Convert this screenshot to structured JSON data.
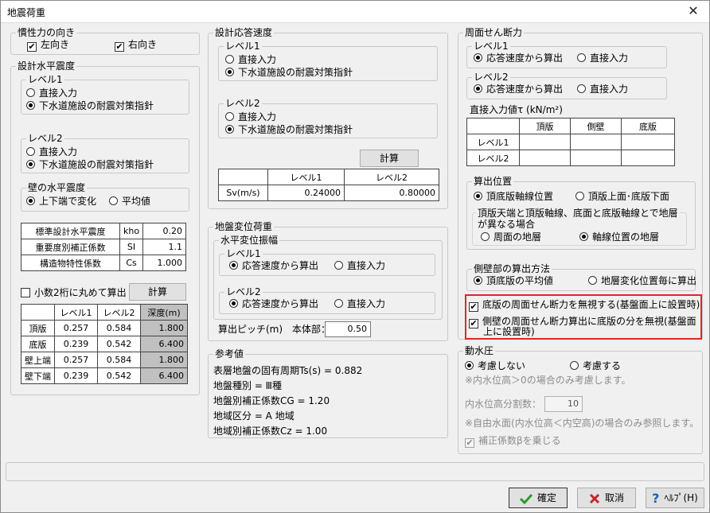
{
  "window": {
    "title": "地震荷重",
    "close": "✕"
  },
  "inertia": {
    "legend": "慣性力の向き",
    "left": {
      "label": "左向き",
      "checked": true
    },
    "right": {
      "label": "右向き",
      "checked": true
    }
  },
  "design_seismic": {
    "legend": "設計水平震度",
    "level1": {
      "legend": "レベル1",
      "opt1": "直接入力",
      "opt2": "下水道施設の耐震対策指針"
    },
    "level2": {
      "legend": "レベル2",
      "opt1": "直接入力",
      "opt2": "下水道施設の耐震対策指針"
    },
    "wall": {
      "legend": "壁の水平震度",
      "opt1": "上下端で変化",
      "opt2": "平均値"
    },
    "params": [
      {
        "label": "標準設計水平震度",
        "sym": "kho",
        "value": "0.20"
      },
      {
        "label": "重要度別補正係数",
        "sym": "SI",
        "value": "1.1"
      },
      {
        "label": "構造物特性係数",
        "sym": "Cs",
        "value": "1.000"
      }
    ],
    "round_label": "小数2桁に丸めて算出",
    "calc_button": "計算",
    "table": {
      "headers": [
        "",
        "レベル1",
        "レベル2",
        "深度(m)"
      ],
      "rows": [
        [
          "頂版",
          "0.257",
          "0.584",
          "1.800"
        ],
        [
          "底版",
          "0.239",
          "0.542",
          "6.400"
        ],
        [
          "壁上端",
          "0.257",
          "0.584",
          "1.800"
        ],
        [
          "壁下端",
          "0.239",
          "0.542",
          "6.400"
        ]
      ]
    }
  },
  "response_velocity": {
    "legend": "設計応答速度",
    "level1": {
      "legend": "レベル1",
      "opt1": "直接入力",
      "opt2": "下水道施設の耐震対策指針"
    },
    "level2": {
      "legend": "レベル2",
      "opt1": "直接入力",
      "opt2": "下水道施設の耐震対策指針"
    },
    "calc_button": "計算",
    "table": {
      "headers": [
        "",
        "レベル1",
        "レベル2"
      ],
      "row": [
        "Sv(m/s)",
        "0.24000",
        "0.80000"
      ]
    }
  },
  "ground_disp": {
    "legend": "地盤変位荷重",
    "sub_legend": "水平変位振幅",
    "level1": {
      "legend": "レベル1",
      "opt1": "応答速度から算出",
      "opt2": "直接入力"
    },
    "level2": {
      "legend": "レベル2",
      "opt1": "応答速度から算出",
      "opt2": "直接入力"
    },
    "pitch_label": "算出ピッチ(m)　本体部：",
    "pitch_value": "0.50"
  },
  "reference": {
    "legend": "参考値",
    "lines": [
      "表層地盤の固有周期Ts(s)  =  0.882",
      "地盤種別 =  Ⅲ種",
      "地盤別補正係数CG =  1.20",
      "地域区分 =  A 地域",
      "地域別補正係数Cz =   1.00"
    ]
  },
  "shear": {
    "legend": "周面せん断力",
    "level1": {
      "legend": "レベル1",
      "opt1": "応答速度から算出",
      "opt2": "直接入力"
    },
    "level2": {
      "legend": "レベル2",
      "opt1": "応答速度から算出",
      "opt2": "直接入力"
    },
    "direct_label": "直接入力値τ (kN/m²)",
    "table": {
      "headers": [
        "",
        "頂版",
        "側壁",
        "底版"
      ],
      "rows": [
        [
          "レベル1",
          "",
          "",
          ""
        ],
        [
          "レベル2",
          "",
          "",
          ""
        ]
      ]
    },
    "position": {
      "legend": "算出位置",
      "opt1": "頂底版軸線位置",
      "opt2": "頂版上面･底版下面",
      "note_line1": "頂版天端と頂版軸線、底面と底版軸線とで地層",
      "note_line2": "が異なる場合",
      "sub_opt1": "周面の地層",
      "sub_opt2": "軸線位置の地層"
    },
    "side": {
      "legend": "側壁部の算出方法",
      "opt1": "頂底版の平均値",
      "opt2": "地層変化位置毎に算出"
    },
    "ignore_bottom": "底版の周面せん断力を無視する(基盤面上に設置時)",
    "ignore_side_line1": "側壁の周面せん断力算出に底版の分を無視(基盤面",
    "ignore_side_line2": "上に設置時)"
  },
  "hydro": {
    "legend": "動水圧",
    "opt1": "考慮しない",
    "opt2": "考慮する",
    "note1": "※内水位高＞0の場合のみ考慮します。",
    "div_label": "内水位高分割数：",
    "div_value": "10",
    "note2": "※自由水面(内水位高＜内空高)の場合のみ参照します。",
    "beta_label": "補正係数βを乗じる"
  },
  "buttons": {
    "ok": "確定",
    "cancel": "取消",
    "help": "ﾍﾙﾌﾟ(H)"
  },
  "colors": {
    "highlight": "#e3242b",
    "ok_check": "#2e9a2e",
    "cancel_x": "#c0282d",
    "help_q": "#1f5fb8"
  }
}
